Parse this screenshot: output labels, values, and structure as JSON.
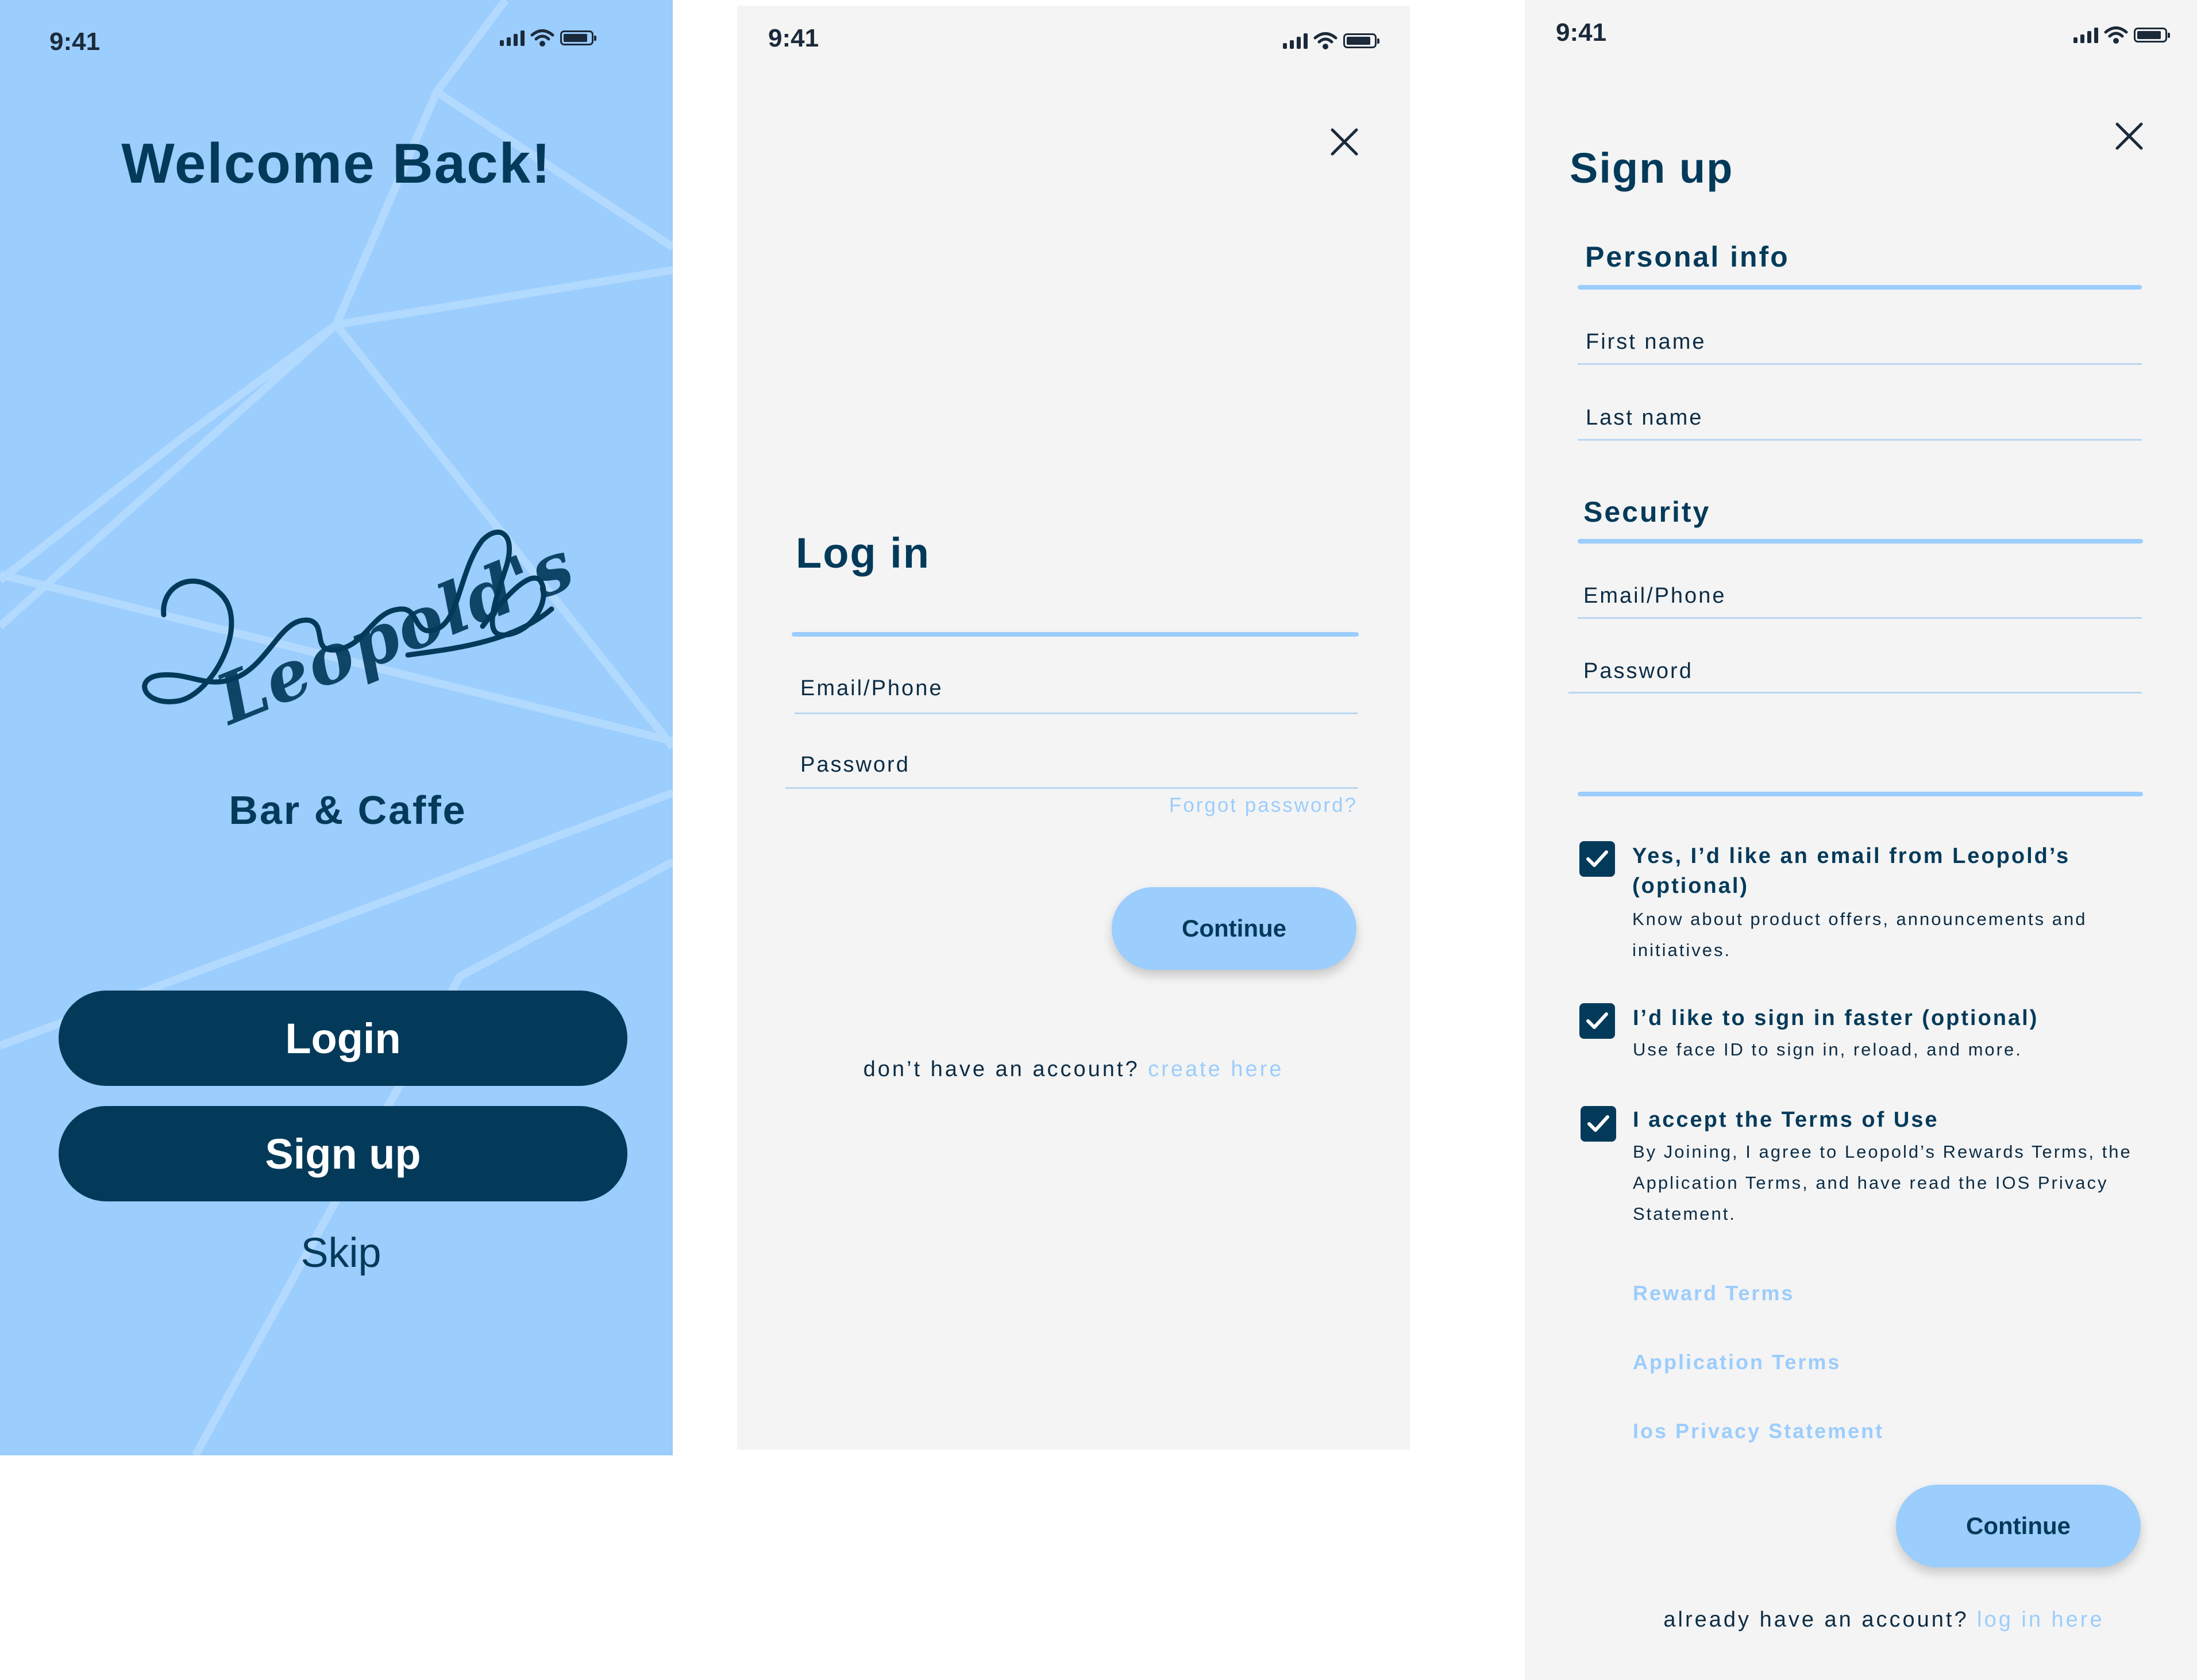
{
  "status_bar": {
    "time": "9:41"
  },
  "colors": {
    "accent": "#9bcdfd",
    "navy": "#033a5a",
    "panel": "#f4f4f4"
  },
  "welcome": {
    "title": "Welcome Back!",
    "logo_text": "Leopold's",
    "subtitle": "Bar & Caffe",
    "login_label": "Login",
    "signup_label": "Sign up",
    "skip_label": "Skip"
  },
  "login": {
    "title": "Log in",
    "email_label": "Email/Phone",
    "password_label": "Password",
    "forgot_label": "Forgot password?",
    "continue_label": "Continue",
    "no_account_text": "don’t have an account?",
    "create_link": "create here"
  },
  "signup": {
    "title": "Sign up",
    "personal_heading": "Personal info",
    "first_name_label": "First name",
    "last_name_label": "Last name",
    "security_heading": "Security",
    "email_label": "Email/Phone",
    "password_label": "Password",
    "options": [
      {
        "title": "Yes, I’d like an email from Leopold’s (optional)",
        "desc": "Know about product offers, announcements and initiatives.",
        "checked": true
      },
      {
        "title": "I’d like to sign in faster (optional)",
        "desc": "Use face ID to sign in, reload, and more.",
        "checked": true
      },
      {
        "title": "I accept the Terms of Use",
        "desc": "By Joining, I agree to Leopold’s Rewards Terms, the Application Terms, and have read the IOS Privacy Statement.",
        "checked": true
      }
    ],
    "reward_terms": "Reward Terms",
    "application_terms": "Application Terms",
    "privacy_statement": "Ios Privacy Statement",
    "continue_label": "Continue",
    "have_account_text": "already have an account?",
    "login_link": "log in here"
  }
}
